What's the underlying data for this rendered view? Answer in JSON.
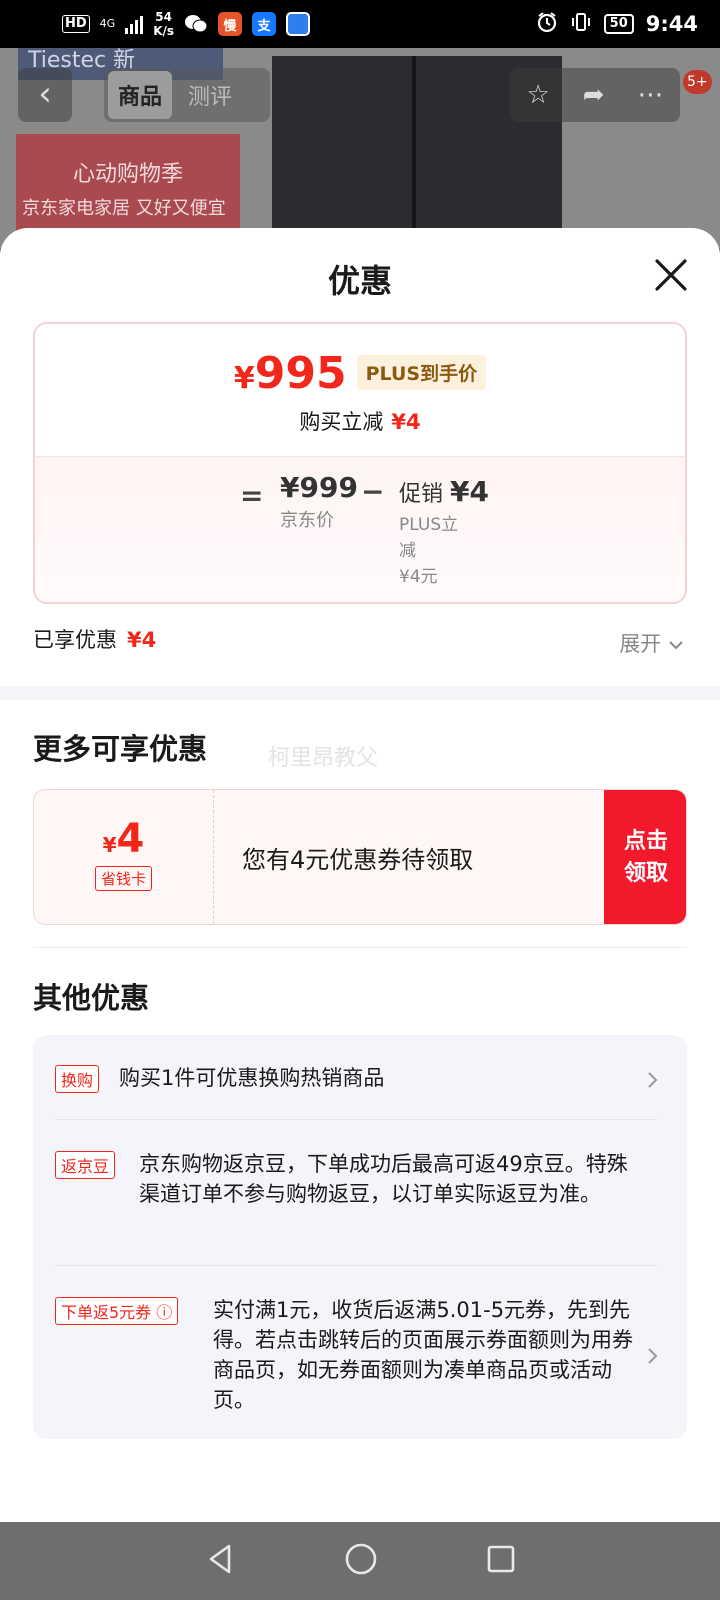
{
  "status_bar": {
    "network_hd": "HD",
    "network_gen": "4G",
    "speed_value": "54",
    "speed_unit": "K/s",
    "app_icons": [
      "wechat-icon",
      "app-man-icon",
      "alipay-icon",
      "browser-icon"
    ],
    "app_glyphs": [
      "慢",
      "支"
    ],
    "battery": "50",
    "time": "9:44"
  },
  "background": {
    "tabs": [
      "商品",
      "测评"
    ],
    "banner_title": "心动购物季",
    "banner_subtitle": "京东家电家居 又好又便宜",
    "logo_text": "Tiestec 新",
    "cart_badge": "5+"
  },
  "sheet": {
    "title": "优惠",
    "price_card": {
      "final_price_symbol": "¥",
      "final_price": "995",
      "plus_label": "PLUS到手价",
      "reduce_label": "购买立减",
      "reduce_amount": "¥4",
      "equals": "=",
      "jd_price": "¥999",
      "jd_price_label": "京东价",
      "minus": "−",
      "promo_label": "促销",
      "promo_amount": "¥4",
      "promo_detail_line1": "PLUS立",
      "promo_detail_line2": "减",
      "promo_detail_line3": "¥4元"
    },
    "enjoyed_label": "已享优惠",
    "enjoyed_amount": "¥4",
    "expand_label": "展开",
    "more_title": "更多可享优惠",
    "watermark": "柯里昂教父",
    "coupon": {
      "symbol": "¥",
      "amount": "4",
      "tag": "省钱卡",
      "text": "您有4元优惠券待领取",
      "button_line1": "点击",
      "button_line2": "领取"
    },
    "other_title": "其他优惠",
    "other_items": [
      {
        "tag": "换购",
        "text": "购买1件可优惠换购热销商品"
      },
      {
        "tag": "返京豆",
        "text": "京东购物返京豆，下单成功后最高可返49京豆。特殊渠道订单不参与购物返豆，以订单实际返豆为准。"
      },
      {
        "tag": "下单返5元券 ⓘ",
        "text": "实付满1元，收货后返满5.01-5元券，先到先得。若点击跳转后的页面展示券面额则为用券商品页，如无券面额则为凑单商品页或活动页。"
      }
    ]
  },
  "colors": {
    "accent_red": "#f2271c",
    "button_red": "#f2192c",
    "plus_bg": "#fdf0dc",
    "plus_text": "#8a5a10"
  }
}
